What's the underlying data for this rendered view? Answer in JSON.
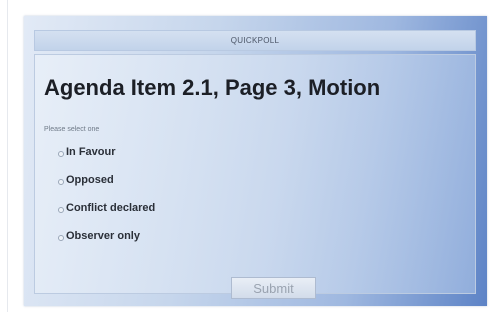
{
  "header": {
    "title": "QUICKPOLL"
  },
  "poll": {
    "title": "Agenda Item 2.1, Page 3, Motion",
    "instruction": "Please select one",
    "options": [
      {
        "label": "In Favour"
      },
      {
        "label": "Opposed"
      },
      {
        "label": "Conflict declared"
      },
      {
        "label": "Observer only"
      }
    ],
    "submit_label": "Submit"
  }
}
